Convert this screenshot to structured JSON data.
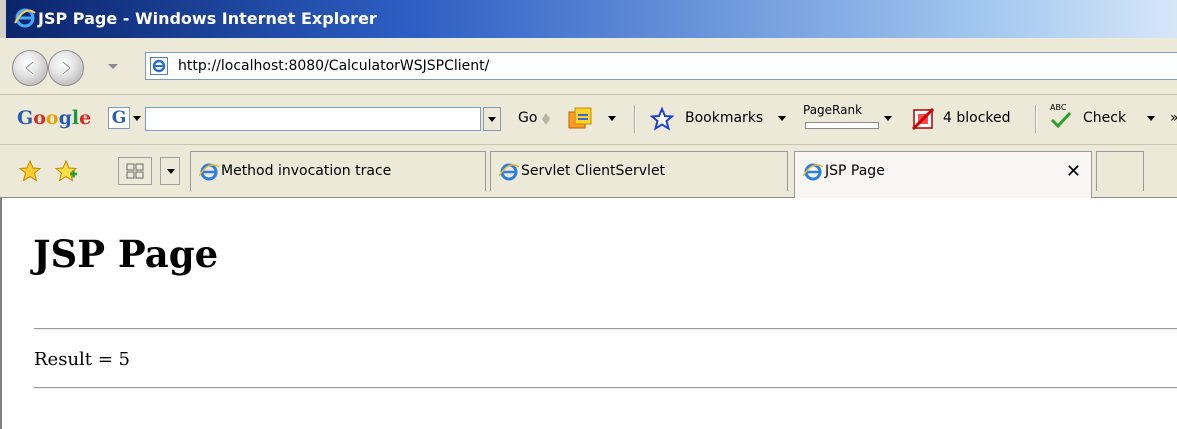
{
  "window": {
    "title": "JSP Page - Windows Internet Explorer"
  },
  "address_bar": {
    "url": "http://localhost:8080/CalculatorWSJSPClient/"
  },
  "google_toolbar": {
    "logo": "Google",
    "go_label": "Go",
    "bookmarks_label": "Bookmarks",
    "pagerank_label": "PageRank",
    "popup_blocked_label": "4 blocked",
    "check_label": "Check",
    "spell_icon_text": "ABC"
  },
  "tabs": [
    {
      "label": "Method invocation trace",
      "active": false
    },
    {
      "label": "Servlet ClientServlet",
      "active": false
    },
    {
      "label": "JSP Page",
      "active": true
    }
  ],
  "page": {
    "heading": "JSP Page",
    "result": "Result = 5"
  },
  "colors": {
    "titlebar_start": "#0a246a",
    "chrome": "#ece9d8"
  }
}
